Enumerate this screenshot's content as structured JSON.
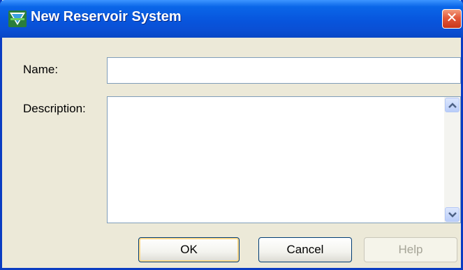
{
  "window": {
    "title": "New Reservoir System",
    "close_glyph": "✕",
    "icon": "reservoir-app-icon"
  },
  "form": {
    "name_label": "Name:",
    "name_value": "",
    "description_label": "Description:",
    "description_value": ""
  },
  "buttons": {
    "ok_label": "OK",
    "cancel_label": "Cancel",
    "help_label": "Help",
    "help_enabled": false
  },
  "colors": {
    "titlebar": "#0855dd",
    "dialog_background": "#ece9d8",
    "close_button": "#e2583a",
    "disabled_text": "#a5a497"
  }
}
